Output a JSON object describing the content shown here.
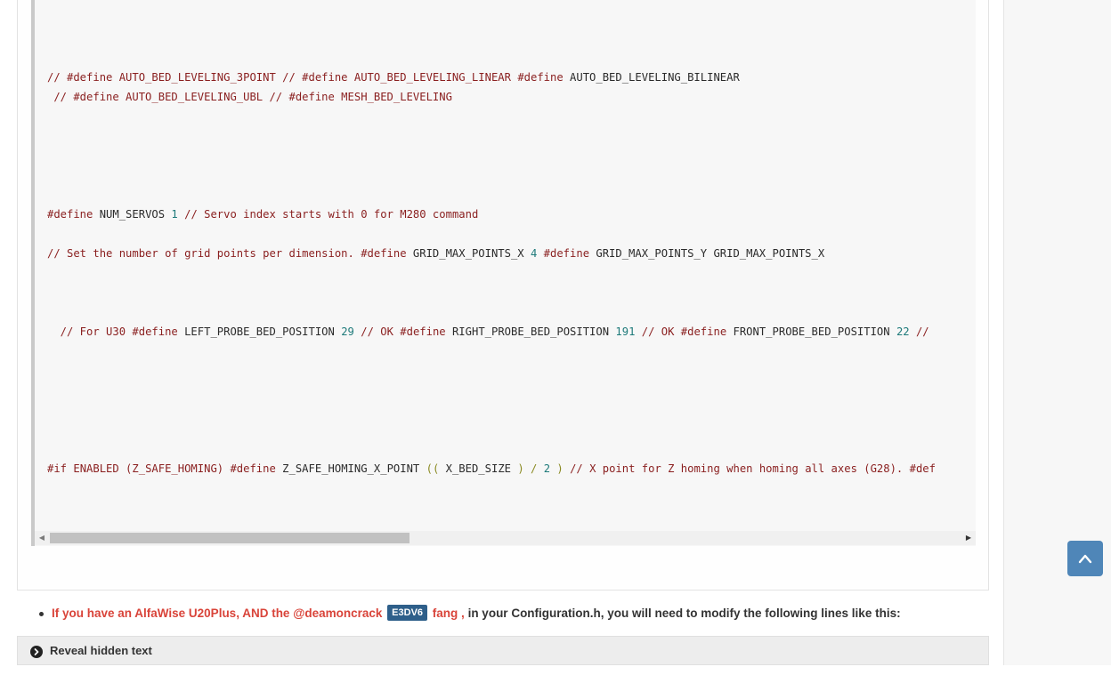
{
  "code_block": {
    "lines": [
      {
        "segments": [
          {
            "c": "cm",
            "t": "// #define AUTO_BED_LEVELING_3POINT // #define AUTO_BED_LEVELING_LINEAR "
          },
          {
            "c": "kw",
            "t": "#define "
          },
          {
            "c": "",
            "t": "AUTO_BED_LEVELING_BILINEAR"
          }
        ]
      },
      {
        "segments": [
          {
            "c": "cm",
            "t": " // #define AUTO_BED_LEVELING_UBL // #define MESH_BED_LEVELING"
          }
        ]
      },
      {
        "segments": [
          {
            "c": "kw",
            "t": "#define "
          },
          {
            "c": "",
            "t": "NUM_SERVOS "
          },
          {
            "c": "num",
            "t": "1"
          },
          {
            "c": "cm",
            "t": " // Servo index starts with 0 for M280 command"
          }
        ]
      },
      {
        "segments": [
          {
            "c": "cm",
            "t": "// Set the number of grid points per dimension. "
          },
          {
            "c": "kw",
            "t": "#define "
          },
          {
            "c": "",
            "t": "GRID_MAX_POINTS_X "
          },
          {
            "c": "num",
            "t": "4"
          },
          {
            "c": "kw",
            "t": " #define "
          },
          {
            "c": "",
            "t": "GRID_MAX_POINTS_Y GRID_MAX_POINTS_X"
          }
        ]
      },
      {
        "segments": [
          {
            "c": "cm",
            "t": "  // For U30 "
          },
          {
            "c": "kw",
            "t": "#define "
          },
          {
            "c": "",
            "t": "LEFT_PROBE_BED_POSITION "
          },
          {
            "c": "num",
            "t": "29"
          },
          {
            "c": "cm",
            "t": " // OK "
          },
          {
            "c": "kw",
            "t": "#define "
          },
          {
            "c": "",
            "t": "RIGHT_PROBE_BED_POSITION "
          },
          {
            "c": "num",
            "t": "191"
          },
          {
            "c": "cm",
            "t": " // OK "
          },
          {
            "c": "kw",
            "t": "#define "
          },
          {
            "c": "",
            "t": "FRONT_PROBE_BED_POSITION "
          },
          {
            "c": "num",
            "t": "22"
          },
          {
            "c": "cm",
            "t": " //"
          }
        ]
      },
      {
        "segments": [
          {
            "c": "kw",
            "t": "#if "
          },
          {
            "c": "",
            "t": ""
          },
          {
            "c": "kw",
            "t": "ENABLED (Z_SAFE_HOMING) #define "
          },
          {
            "c": "",
            "t": "Z_SAFE_HOMING_X_POINT "
          },
          {
            "c": "op",
            "t": "(( "
          },
          {
            "c": "",
            "t": "X_BED_SIZE "
          },
          {
            "c": "op",
            "t": ") / "
          },
          {
            "c": "num",
            "t": "2"
          },
          {
            "c": "op",
            "t": " ) "
          },
          {
            "c": "cm",
            "t": "// X point for Z homing when homing all axes (G28). #def"
          }
        ]
      }
    ]
  },
  "bullet": {
    "part1": "If you have an AlfaWise U20Plus, AND the @deamoncrack",
    "tag": "E3DV6",
    "part2": "fang ,",
    "part3": " in your Configuration.h, you will need to modify the following lines like this:"
  },
  "spoiler": {
    "label": "Reveal hidden text",
    "icon": "chevron-circle-right-icon"
  },
  "back_to_top": {
    "icon": "chevron-up-icon"
  },
  "colors": {
    "keyword": "#8a1f1f",
    "number": "#1e7a7a",
    "accent_link": "#d9443a",
    "tag_bg": "#2e5f8a",
    "back_top_bg": "#4f86b8"
  }
}
